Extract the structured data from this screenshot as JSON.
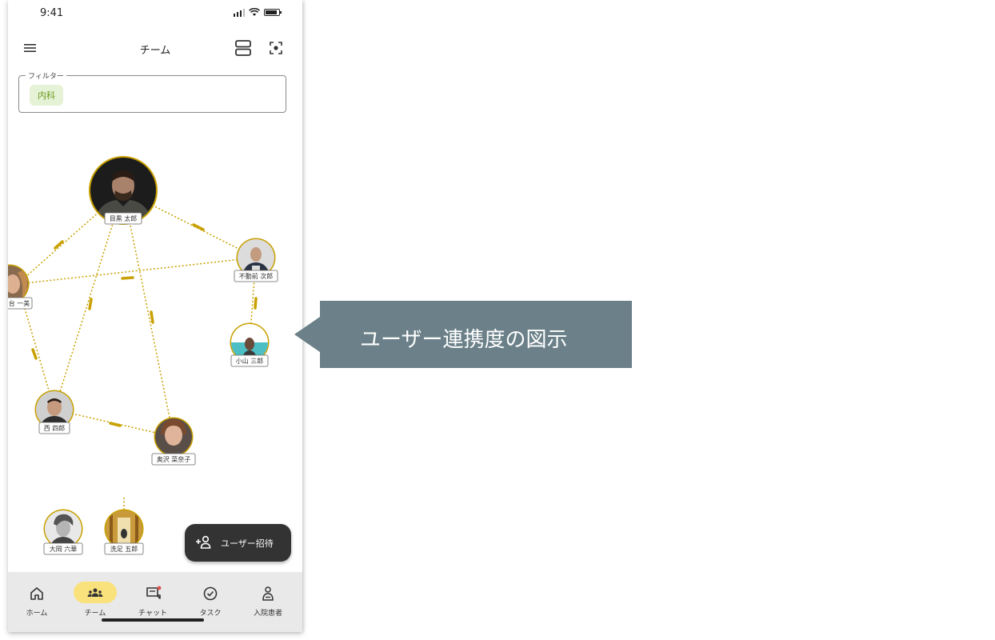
{
  "status_bar": {
    "time": "9:41"
  },
  "app_bar": {
    "title": "チーム",
    "menu_icon": "menu-icon",
    "view_icon": "view-agenda-icon",
    "focus_icon": "center-focus-icon"
  },
  "filter": {
    "label": "フィルター",
    "chip": "内科"
  },
  "graph": {
    "nodes": [
      {
        "id": "meguro",
        "name": "目黒 太郎",
        "highlight": true
      },
      {
        "id": "fudomae",
        "name": "不動前 次郎"
      },
      {
        "id": "koyama",
        "name": "小山 三郎"
      },
      {
        "id": "nishi",
        "name": "西 四郎"
      },
      {
        "id": "okusawa",
        "name": "奥沢 菜奈子"
      },
      {
        "id": "hitomi",
        "name": "台 一美"
      },
      {
        "id": "ooka",
        "name": "大岡 六華"
      },
      {
        "id": "senzoku",
        "name": "洗足 五郎"
      }
    ],
    "link_color": "#c8a000"
  },
  "fab": {
    "label": "ユーザー招待",
    "icon": "person-add-icon"
  },
  "bottom_nav": {
    "items": [
      {
        "label": "ホーム",
        "icon": "home-icon",
        "active": false
      },
      {
        "label": "チーム",
        "icon": "groups-icon",
        "active": true
      },
      {
        "label": "チャット",
        "icon": "chat-icon",
        "active": false,
        "badge": true
      },
      {
        "label": "タスク",
        "icon": "task-check-icon",
        "active": false
      },
      {
        "label": "入院患者",
        "icon": "inpatient-icon",
        "active": false
      }
    ],
    "active_color": "#f9e27b"
  },
  "callout": {
    "text": "ユーザー連携度の図示",
    "color": "#6b8088"
  }
}
